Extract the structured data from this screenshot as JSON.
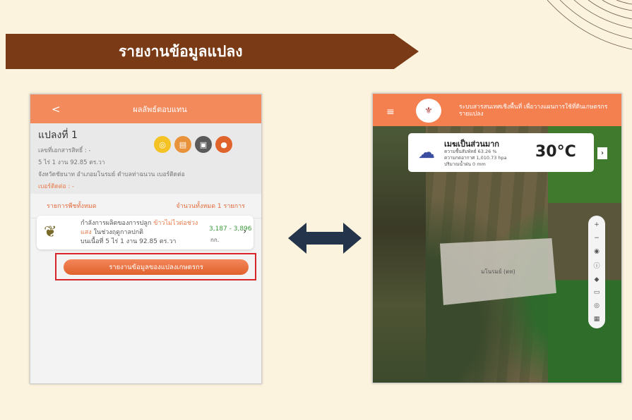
{
  "banner": {
    "title": "รายงานข้อมูลแปลง"
  },
  "left_phone": {
    "header": {
      "back": "<",
      "title": "ผลลัพธ์ตอบแทน"
    },
    "info": {
      "title": "แปลงที่ 1",
      "doc": "เลขที่เอกสารสิทธิ์ : -",
      "area": "5 ไร่ 1 งาน 92.85 ตร.วา",
      "location": "จังหวัดชัยนาท อำเภอมโนรมย์ ตำบลท่าฉนวน เบอร์ติดต่อ",
      "phone": "เบอร์ติดต่อ : -"
    },
    "icons": [
      "coins-icon",
      "document-icon",
      "table-icon",
      "map-pin-icon"
    ],
    "tabs": {
      "all_plants": "รายการพืชทั้งหมด",
      "count": "จำนวนทั้งหมด 1 รายการ"
    },
    "card": {
      "line1": "กำลังการผลิตของการปลูก ",
      "crop": "ข้าวไม่ไวต่อช่วงแสง",
      "line2": " ในช่วงฤดูกาลปกติ",
      "line3": "บนเนื้อที่ 5 ไร่ 1 งาน 92.85 ตร.วา",
      "value": "3,187 - 3,896",
      "unit": "กก."
    },
    "report_button": "รายงานข้อมูลของแปลงเกษตรกร"
  },
  "right_phone": {
    "header": {
      "menu": "≡",
      "title": "ระบบสารสนเทศเชิงพื้นที่ เพื่อวางแผนการใช้ที่ดินเกษตรกรรายแปลง"
    },
    "weather": {
      "condition": "เมฆเป็นส่วนมาก",
      "humidity": "ความชื้นสัมพัทธ์ 63.26 %",
      "pressure": "ความกดอากาศ 1,010.73 hpa",
      "rain": "ปริมาณน้ำฝน 0 mm",
      "temp": "30°C"
    },
    "parcel_label": "มโนรมย์ (ตท)",
    "tools": [
      "+",
      "−",
      "◉",
      "ⓘ",
      "◆",
      "▭",
      "◎",
      "▦"
    ]
  },
  "colors": {
    "banner": "#7a3a16",
    "accent": "#f28a5c",
    "highlight_box": "#d6262a",
    "arrow": "#24344a"
  }
}
